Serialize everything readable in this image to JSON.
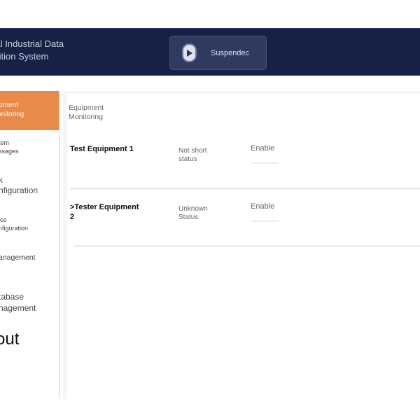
{
  "header": {
    "title_line1": "eral Industrial Data",
    "title_line2": "uisition System",
    "suspend_label": "Suspendec",
    "play_icon": "play-icon"
  },
  "sidebar": {
    "items": [
      {
        "line1": "ipment",
        "line2": "onitoring",
        "active": true
      },
      {
        "line1": "tem",
        "line2": "ssages",
        "active": false
      },
      {
        "line1": "k",
        "line2": "nfiguration",
        "active": false
      },
      {
        "line1": "ice",
        "line2": "nfiguration",
        "active": false
      },
      {
        "line1": "anagement",
        "line2": "",
        "active": false
      },
      {
        "line1": "tabase",
        "line2": "nagement",
        "active": false
      },
      {
        "line1": "out",
        "line2": "",
        "active": false
      }
    ]
  },
  "main": {
    "section_line1": "Equipment",
    "section_line2": "Monitoring",
    "devices": [
      {
        "name_line1": "Test Equipment 1",
        "name_line2": "",
        "status_line1": "Not short",
        "status_line2": "status",
        "action": "Enable"
      },
      {
        "name_line1": ">Tester Equipment",
        "name_line2": "2",
        "status_line1": "Unknown",
        "status_line2": "Status",
        "action": "Enable"
      }
    ]
  },
  "colors": {
    "header_bg": "#172146",
    "active_nav_bg": "#e88a4a",
    "button_bg": "#303a61"
  }
}
